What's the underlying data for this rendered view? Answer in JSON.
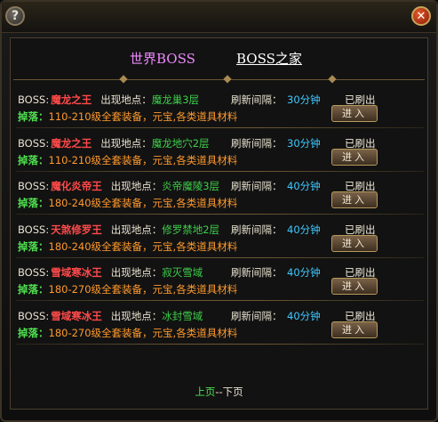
{
  "window": {
    "help_icon": "question-mark-icon",
    "close_icon": "close-x-icon",
    "help_glyph": "?",
    "close_glyph": "✕"
  },
  "tabs": {
    "world": "世界BOSS",
    "home": "BOSS之家"
  },
  "labels": {
    "boss": "BOSS:",
    "location": "出现地点：",
    "refresh": "刷新间隔：",
    "drop": "掉落：",
    "enter": "进入"
  },
  "bosses": [
    {
      "name": "魔龙之王",
      "location": "魔龙巢3层",
      "interval": "30分钟",
      "status": "已刷出",
      "drop": "110-210级全套装备，元宝,各类道具材料"
    },
    {
      "name": "魔龙之王",
      "location": "魔龙地穴2层",
      "interval": "30分钟",
      "status": "已刷出",
      "drop": "110-210级全套装备，元宝,各类道具材料"
    },
    {
      "name": "魔化炎帝王",
      "location": "炎帝魔陵3层",
      "interval": "40分钟",
      "status": "已刷出",
      "drop": "180-240级全套装备，元宝,各类道具材料"
    },
    {
      "name": "天煞修罗王",
      "location": "修罗禁地2层",
      "interval": "40分钟",
      "status": "已刷出",
      "drop": "180-240级全套装备，元宝,各类道具材料"
    },
    {
      "name": "雪域寒冰王",
      "location": "寂灭雪域",
      "interval": "40分钟",
      "status": "已刷出",
      "drop": "180-270级全套装备，元宝,各类道具材料"
    },
    {
      "name": "雪域寒冰王",
      "location": "冰封雪域",
      "interval": "40分钟",
      "status": "已刷出",
      "drop": "180-270级全套装备，元宝,各类道具材料"
    }
  ],
  "pager": {
    "prev": "上页",
    "sep": "--",
    "next": "下页"
  },
  "colors": {
    "boss_name": "#ff4a4a",
    "location": "#3ecf4a",
    "interval": "#3fc8ff",
    "drop": "#ff9a2e",
    "tab_world": "#ee88ff"
  }
}
